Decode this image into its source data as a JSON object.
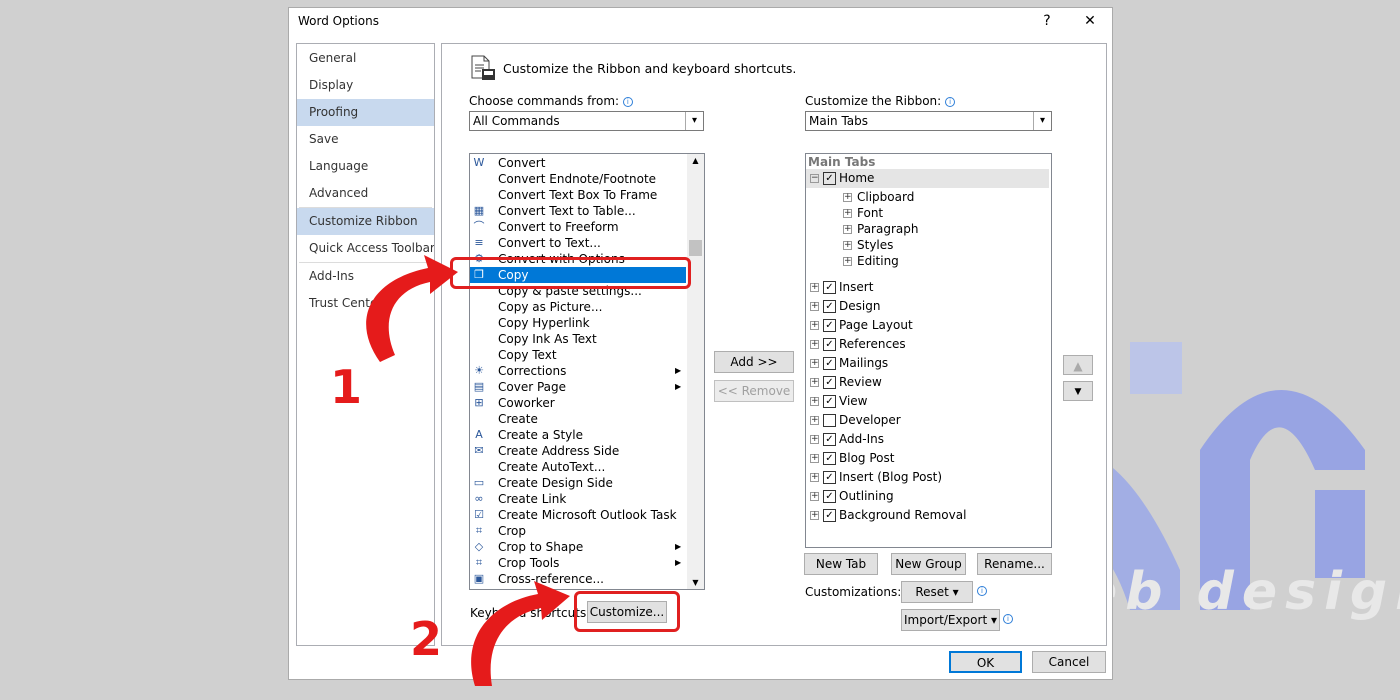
{
  "watermark": {
    "text": "Web design"
  },
  "dialog": {
    "title": "Word Options",
    "help": "?",
    "close": "✕"
  },
  "sidebar": {
    "items": [
      {
        "label": "General"
      },
      {
        "label": "Display"
      },
      {
        "label": "Proofing"
      },
      {
        "label": "Save"
      },
      {
        "label": "Language"
      },
      {
        "label": "Advanced"
      },
      {
        "label": "Customize Ribbon"
      },
      {
        "label": "Quick Access Toolbar"
      },
      {
        "label": "Add-Ins"
      },
      {
        "label": "Trust Center"
      }
    ]
  },
  "main": {
    "header": "Customize the Ribbon and keyboard shortcuts.",
    "choose_label": "Choose commands from:",
    "choose_value": "All Commands",
    "ribbon_label": "Customize the Ribbon:",
    "ribbon_value": "Main Tabs",
    "commands": [
      {
        "label": "Convert",
        "icon": "word-doc-icon"
      },
      {
        "label": "Convert Endnote/Footnote",
        "icon": ""
      },
      {
        "label": "Convert Text Box To Frame",
        "icon": ""
      },
      {
        "label": "Convert Text to Table...",
        "icon": "table-icon"
      },
      {
        "label": "Convert to Freeform",
        "icon": "freeform-icon"
      },
      {
        "label": "Convert to Text...",
        "icon": "text-icon"
      },
      {
        "label": "Convert with Options",
        "icon": "options-icon"
      },
      {
        "label": "Copy",
        "icon": "copy-icon"
      },
      {
        "label": "Copy & paste settings...",
        "icon": ""
      },
      {
        "label": "Copy as Picture...",
        "icon": ""
      },
      {
        "label": "Copy Hyperlink",
        "icon": ""
      },
      {
        "label": "Copy Ink As Text",
        "icon": ""
      },
      {
        "label": "Copy Text",
        "icon": ""
      },
      {
        "label": "Corrections",
        "icon": "sun-icon"
      },
      {
        "label": "Cover Page",
        "icon": "page-icon"
      },
      {
        "label": "Coworker",
        "icon": "org-icon"
      },
      {
        "label": "Create",
        "icon": ""
      },
      {
        "label": "Create a Style",
        "icon": "style-icon"
      },
      {
        "label": "Create Address Side",
        "icon": "address-icon"
      },
      {
        "label": "Create AutoText...",
        "icon": ""
      },
      {
        "label": "Create Design Side",
        "icon": "design-icon"
      },
      {
        "label": "Create Link",
        "icon": "link-icon"
      },
      {
        "label": "Create Microsoft Outlook Task",
        "icon": "task-icon"
      },
      {
        "label": "Crop",
        "icon": "crop-icon"
      },
      {
        "label": "Crop to Shape",
        "icon": "crop-shape-icon"
      },
      {
        "label": "Crop Tools",
        "icon": "crop-icon"
      },
      {
        "label": "Cross-reference...",
        "icon": "xref-icon"
      }
    ],
    "add_button": "Add >>",
    "remove_button": "<< Remove",
    "tree_header": "Main Tabs",
    "tree": [
      {
        "label": "Home",
        "checked": true,
        "expanded": true
      },
      {
        "label": "Clipboard",
        "child": true
      },
      {
        "label": "Font",
        "child": true
      },
      {
        "label": "Paragraph",
        "child": true
      },
      {
        "label": "Styles",
        "child": true
      },
      {
        "label": "Editing",
        "child": true
      },
      {
        "label": "Insert",
        "checked": true
      },
      {
        "label": "Design",
        "checked": true
      },
      {
        "label": "Page Layout",
        "checked": true
      },
      {
        "label": "References",
        "checked": true
      },
      {
        "label": "Mailings",
        "checked": true
      },
      {
        "label": "Review",
        "checked": true
      },
      {
        "label": "View",
        "checked": true
      },
      {
        "label": "Developer",
        "checked": false
      },
      {
        "label": "Add-Ins",
        "checked": true
      },
      {
        "label": "Blog Post",
        "checked": true
      },
      {
        "label": "Insert (Blog Post)",
        "checked": true
      },
      {
        "label": "Outlining",
        "checked": true
      },
      {
        "label": "Background Removal",
        "checked": true
      }
    ],
    "new_tab": "New Tab",
    "new_group": "New Group",
    "rename": "Rename...",
    "customizations_label": "Customizations:",
    "reset": "Reset",
    "import_export": "Import/Export",
    "keyboard_label": "Keyboard shortcuts:",
    "customize_button": "Customize..."
  },
  "footer": {
    "ok": "OK",
    "cancel": "Cancel"
  },
  "annotations": {
    "step1": "1",
    "step2": "2"
  },
  "colors": {
    "selection": "#0078d7",
    "sidebar_selected": "#c8d9ee",
    "annotation": "#e02020"
  }
}
